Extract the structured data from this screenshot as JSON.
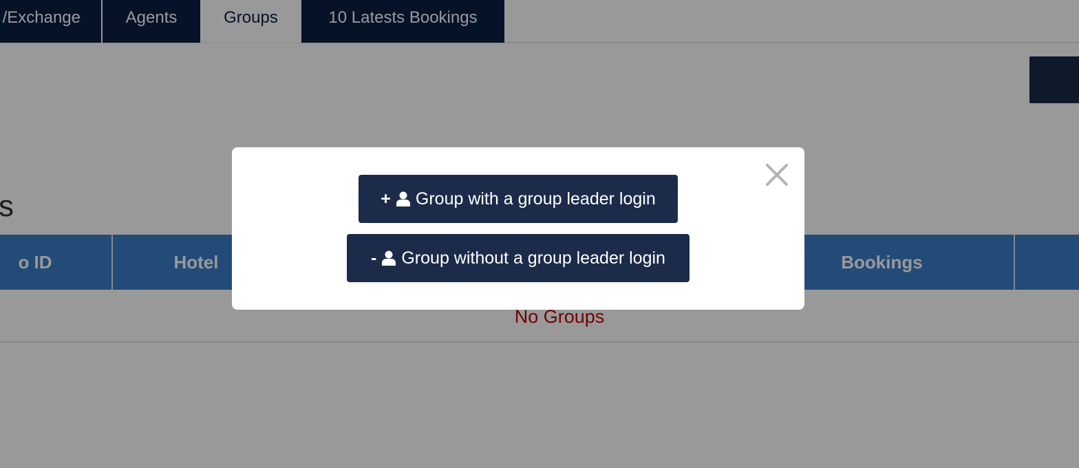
{
  "tabs": [
    {
      "label": "/Exchange",
      "active": false
    },
    {
      "label": "Agents",
      "active": false
    },
    {
      "label": "Groups",
      "active": true
    },
    {
      "label": "10 Latests Bookings",
      "active": false
    }
  ],
  "section": {
    "title_fragment": "s"
  },
  "table": {
    "headers": [
      "o ID",
      "Hotel",
      "Bookings"
    ],
    "empty_message": "No Groups"
  },
  "modal": {
    "close_icon": "close-icon",
    "buttons": [
      {
        "sign": "+",
        "icon": "user-icon",
        "label": "Group with a group leader login"
      },
      {
        "sign": "-",
        "icon": "user-icon",
        "label": "Group without a group leader login"
      }
    ]
  },
  "colors": {
    "navy": "#0b1f44",
    "button": "#1c2b4a",
    "table_header": "#3b7ec7",
    "empty_text": "#c00000",
    "backdrop": "rgba(0,0,0,0.4)"
  }
}
